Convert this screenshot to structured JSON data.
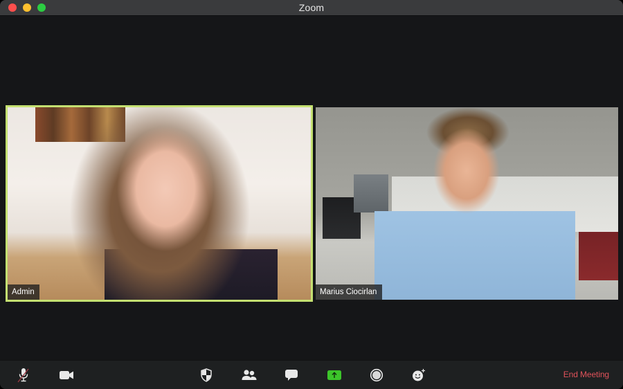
{
  "window": {
    "title": "Zoom",
    "controls": [
      "close",
      "minimize",
      "maximize"
    ]
  },
  "participants": [
    {
      "name": "Admin",
      "active_speaker": true,
      "highlight_color": "#c4e071"
    },
    {
      "name": "Marius Ciocirlan",
      "active_speaker": false
    }
  ],
  "toolbar": {
    "buttons": [
      {
        "id": "mute",
        "icon": "microphone-muted-icon",
        "state": "muted"
      },
      {
        "id": "video",
        "icon": "video-camera-icon"
      },
      {
        "id": "security",
        "icon": "shield-icon"
      },
      {
        "id": "participants",
        "icon": "participants-icon"
      },
      {
        "id": "chat",
        "icon": "chat-bubble-icon"
      },
      {
        "id": "share-screen",
        "icon": "share-screen-icon",
        "accent": "#3cc52a"
      },
      {
        "id": "record",
        "icon": "record-icon"
      },
      {
        "id": "reactions",
        "icon": "reactions-icon"
      }
    ],
    "end_meeting_label": "End Meeting",
    "end_meeting_color": "#e0525a"
  }
}
